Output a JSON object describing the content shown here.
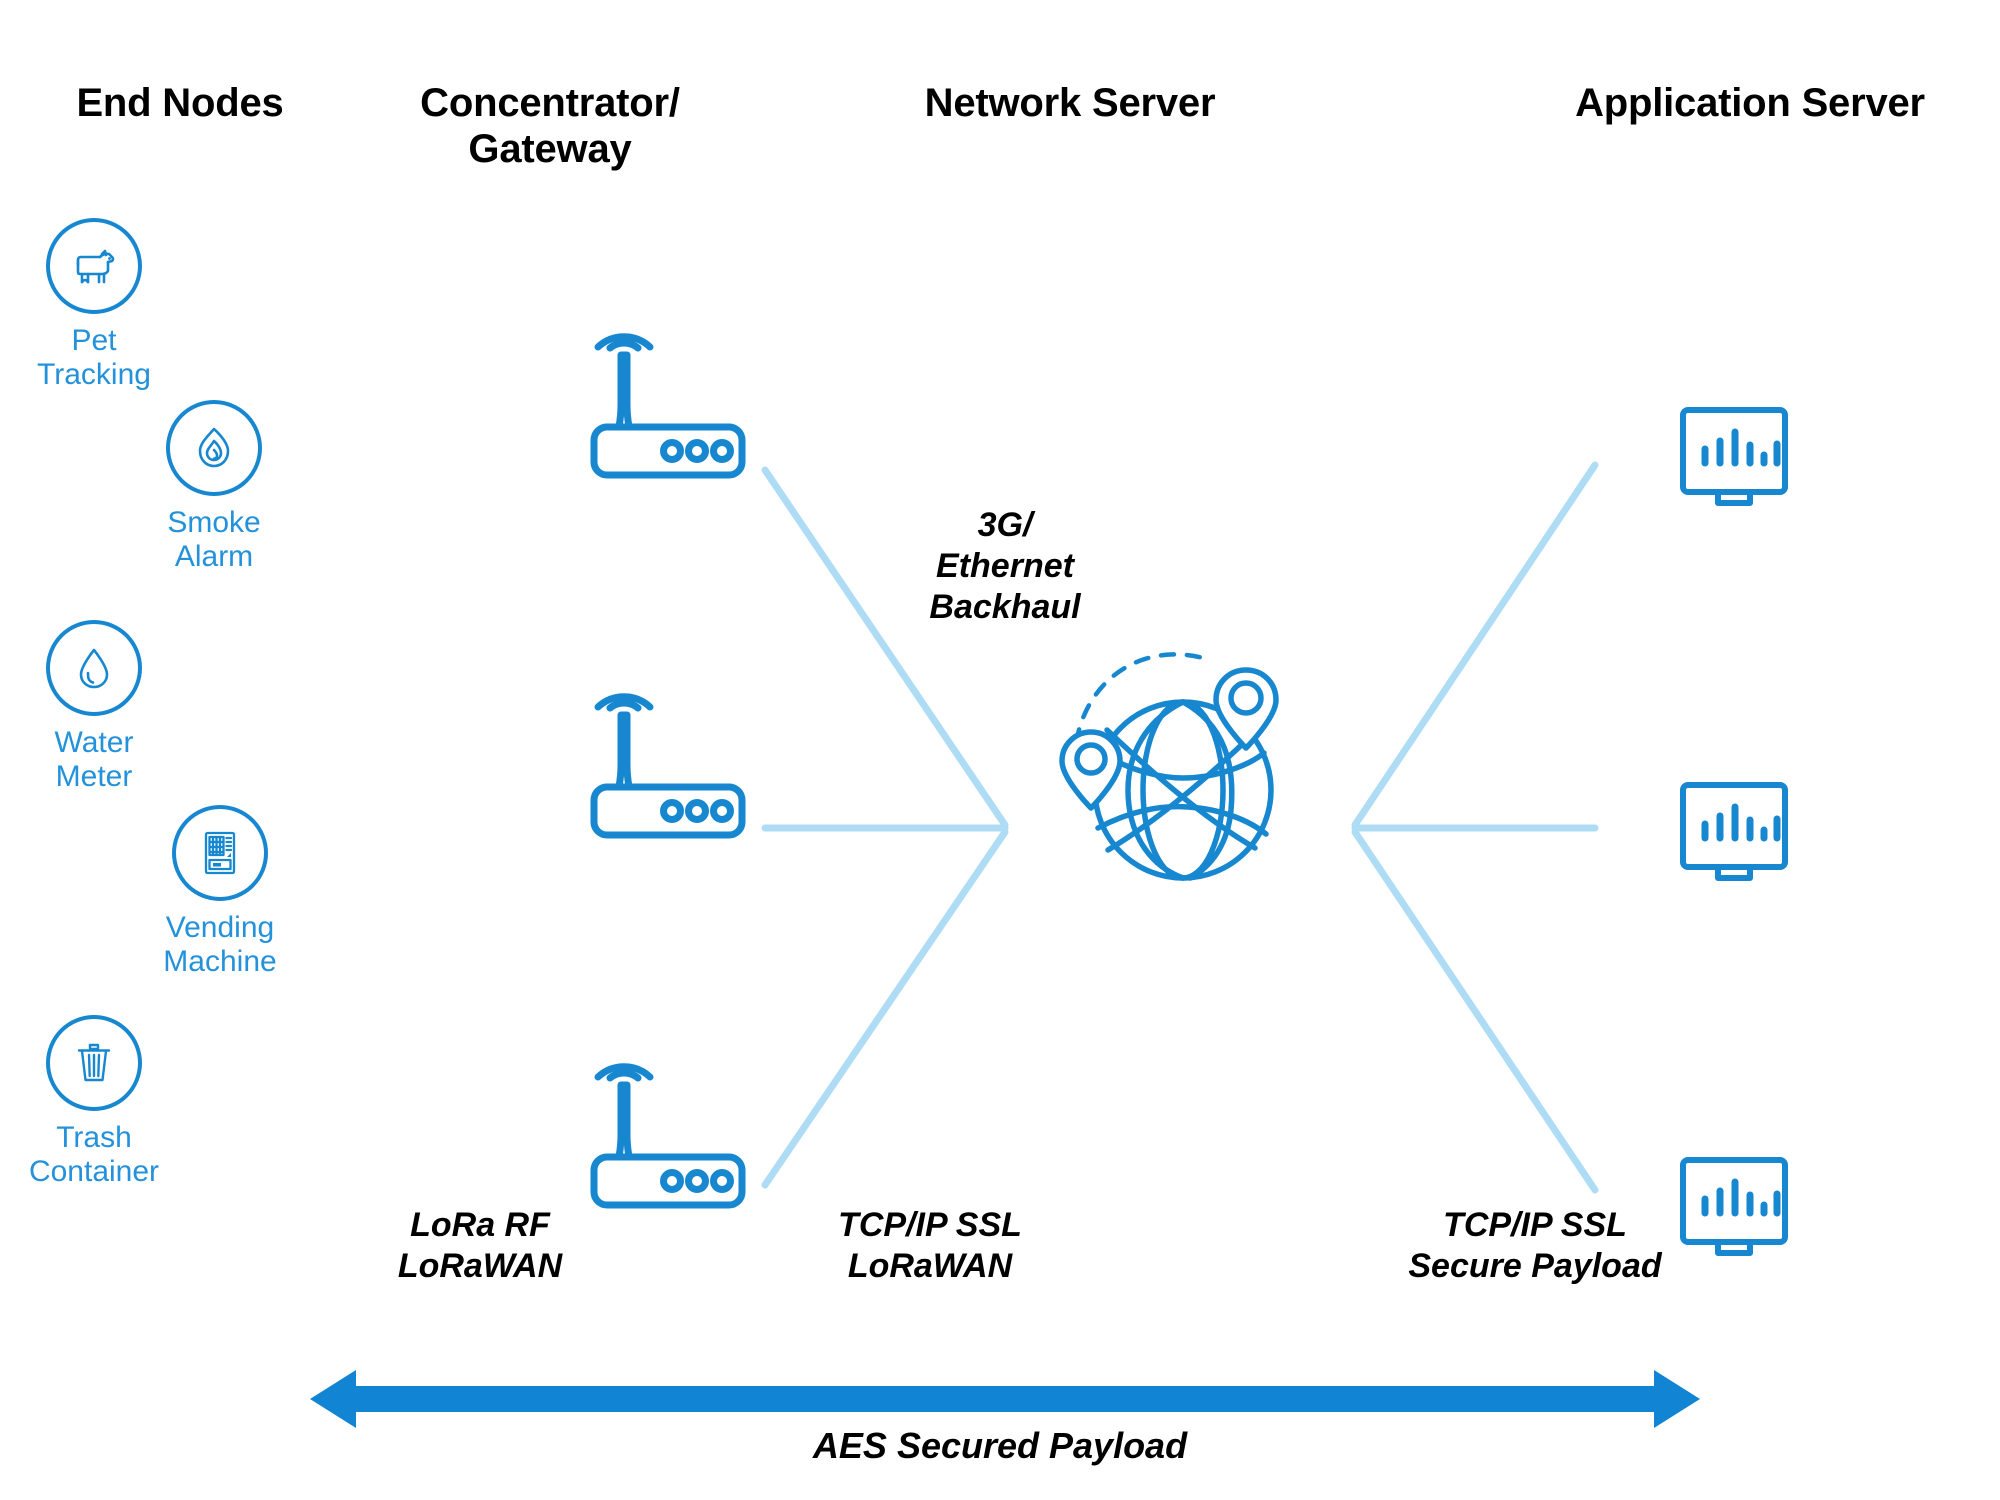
{
  "columns": {
    "end_nodes": "End Nodes",
    "gateway": "Concentrator/\nGateway",
    "network_server": "Network Server",
    "application_server": "Application Server"
  },
  "end_nodes": [
    {
      "label": "Pet\nTracking",
      "icon": "dog-icon"
    },
    {
      "label": "Smoke\nAlarm",
      "icon": "flame-icon"
    },
    {
      "label": "Water\nMeter",
      "icon": "water-drop-icon"
    },
    {
      "label": "Vending\nMachine",
      "icon": "vending-machine-icon"
    },
    {
      "label": "Trash\nContainer",
      "icon": "trash-bin-icon"
    }
  ],
  "gateways": [
    {
      "name": "gateway-router-icon"
    },
    {
      "name": "gateway-router-icon"
    },
    {
      "name": "gateway-router-icon"
    }
  ],
  "network_server": {
    "icon": "globe-with-location-pins-icon"
  },
  "application_servers": [
    {
      "name": "monitor-bar-chart-icon"
    },
    {
      "name": "monitor-bar-chart-icon"
    },
    {
      "name": "monitor-bar-chart-icon"
    }
  ],
  "annotations": {
    "backhaul": "3G/\nEthernet\nBackhaul",
    "lora_rf": "LoRa RF\nLoRaWAN",
    "tcpip_lorawan": "TCP/IP SSL\nLoRaWAN",
    "tcpip_secure_payload": "TCP/IP SSL\nSecure Payload",
    "aes": "AES Secured Payload"
  },
  "colors": {
    "icon_blue": "#1787D0",
    "label_blue": "#2392DA",
    "connector_light_blue": "#AEDCF5",
    "arrow_blue": "#1184D3",
    "text_black": "#000000",
    "background": "#FFFFFF"
  }
}
